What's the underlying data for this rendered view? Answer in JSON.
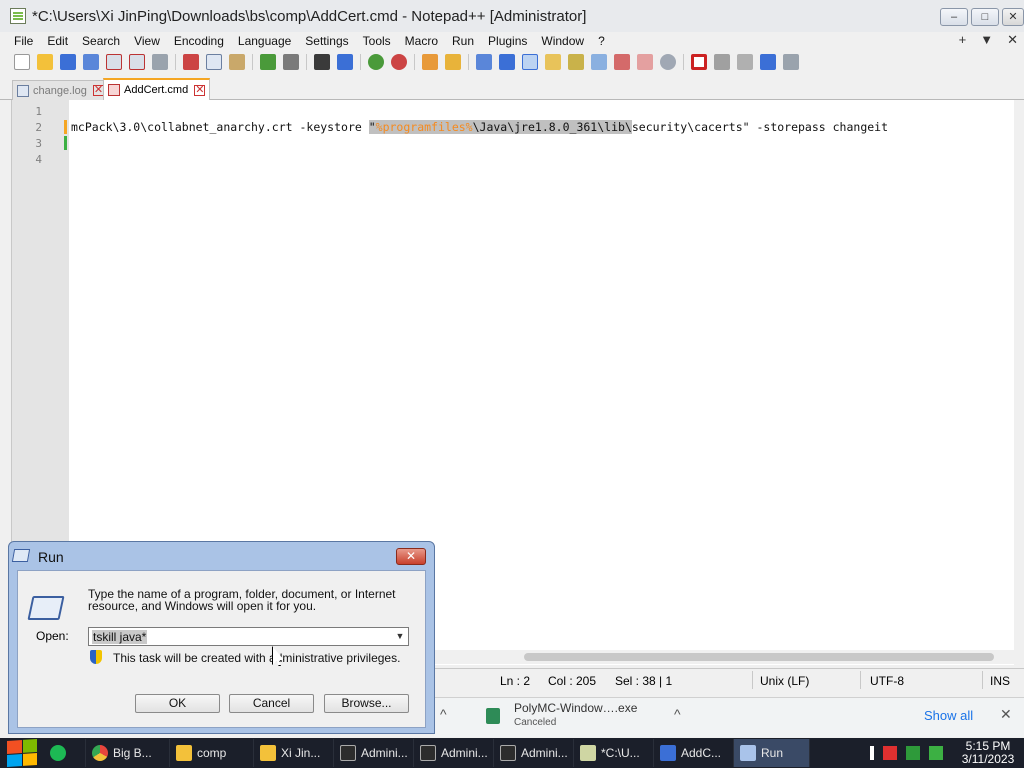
{
  "window": {
    "title": "*C:\\Users\\Xi JinPing\\Downloads\\bs\\comp\\AddCert.cmd - Notepad++ [Administrator]",
    "controls": {
      "minimize": "–",
      "maximize": "□",
      "close": "✕"
    }
  },
  "menu": {
    "items": [
      "File",
      "Edit",
      "Search",
      "View",
      "Encoding",
      "Language",
      "Settings",
      "Tools",
      "Macro",
      "Run",
      "Plugins",
      "Window",
      "?"
    ],
    "right": {
      "add": "+",
      "dropdown": "▼",
      "close": "✕"
    }
  },
  "tabs": [
    {
      "label": "change.log",
      "active": false
    },
    {
      "label": "AddCert.cmd",
      "active": true
    }
  ],
  "editor": {
    "line_numbers": [
      "1",
      "2",
      "3",
      "4"
    ],
    "line2": {
      "before": "mcPack\\3.0\\collabnet_anarchy.crt -keystore ",
      "quote_open": "\"",
      "var": "%programfiles%",
      "path": "\\Java\\jre1.8.0_361\\lib\\",
      "after": "security\\cacerts\" -storepass changeit"
    }
  },
  "status": {
    "ln": "Ln : 2",
    "col": "Col : 205",
    "sel": "Sel : 38 | 1",
    "eol": "Unix (LF)",
    "encoding": "UTF-8",
    "mode": "INS"
  },
  "download": {
    "filename": "PolyMC-Window….exe",
    "state": "Canceled",
    "show_all": "Show all",
    "chevron": "^",
    "close": "✕"
  },
  "run_dialog": {
    "title": "Run",
    "close": "✕",
    "description": "Type the name of a program, folder, document, or Internet resource, and Windows will open it for you.",
    "open_label": "Open:",
    "input_value": "tskill java*",
    "admin_note": "This task will be created with administrative privileges.",
    "ok": "OK",
    "cancel": "Cancel",
    "browse": "Browse..."
  },
  "taskbar": {
    "items": [
      {
        "label": "",
        "icon_color": "#1db954",
        "icon": "spotify-icon"
      },
      {
        "label": "Big B...",
        "icon_color": "#e8453c",
        "icon": "chrome-icon"
      },
      {
        "label": "comp",
        "icon_color": "#f3c13a",
        "icon": "folder-icon"
      },
      {
        "label": "Xi Jin...",
        "icon_color": "#f3c13a",
        "icon": "folder-icon"
      },
      {
        "label": "Admini...",
        "icon_color": "#2c2c2c",
        "icon": "cmd-icon"
      },
      {
        "label": "Admini...",
        "icon_color": "#2c2c2c",
        "icon": "cmd-icon"
      },
      {
        "label": "Admini...",
        "icon_color": "#2c2c2c",
        "icon": "cmd-icon"
      },
      {
        "label": "*C:\\U...",
        "icon_color": "#cfd6a3",
        "icon": "notepadpp-icon"
      },
      {
        "label": "AddC...",
        "icon_color": "#3b6fd6",
        "icon": "vscode-icon"
      },
      {
        "label": "Run",
        "icon_color": "#a9c3ea",
        "icon": "run-icon"
      }
    ],
    "clock_time": "5:15 PM",
    "clock_date": "3/11/2023"
  }
}
